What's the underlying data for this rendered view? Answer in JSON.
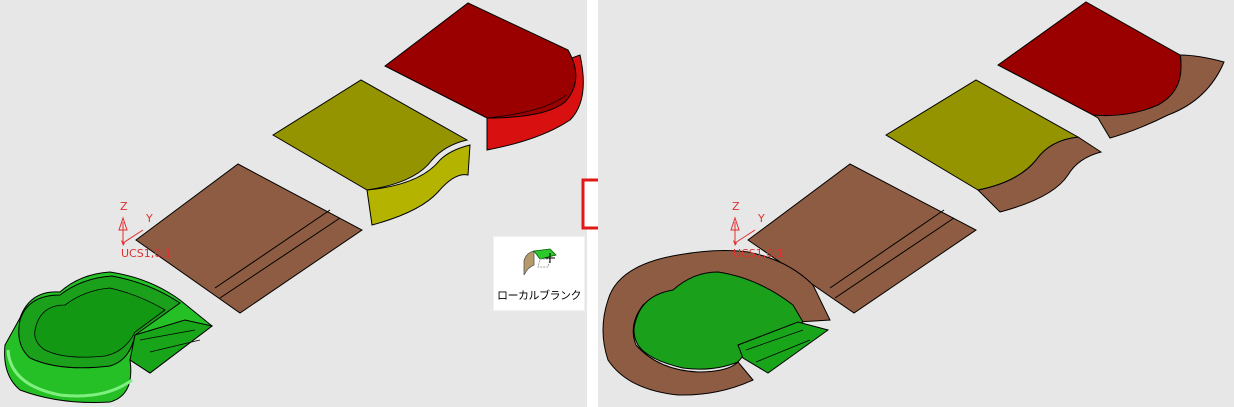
{
  "left_view": {
    "ucs": {
      "z_label": "Z",
      "y_label": "Y",
      "name_label": "UCS1,0,1"
    }
  },
  "right_view": {
    "ucs": {
      "z_label": "Z",
      "y_label": "Y",
      "name_label": "UCS1,0,1"
    }
  },
  "tool": {
    "icon": "local-blank-icon",
    "label": "ローカルブランク"
  },
  "transition": {
    "icon": "right-arrow-icon"
  },
  "colors": {
    "background": "#e7e7e7",
    "red_part": "#9b0000",
    "yellow_part": "#949400",
    "brown_part": "#8e5c42",
    "green_part": "#1fb11f",
    "ucs_red": "#e03030"
  }
}
